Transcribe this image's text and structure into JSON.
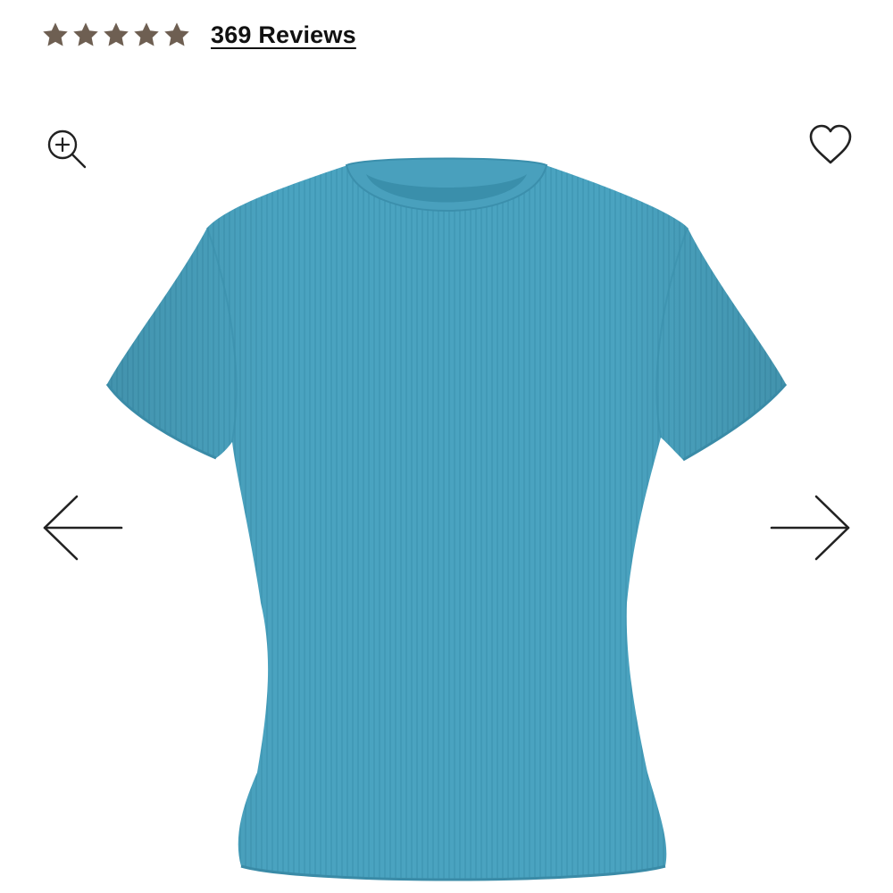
{
  "rating": {
    "stars_filled": 5,
    "stars_total": 5,
    "star_color": "#6e5f52",
    "reviews_label": "369 Reviews"
  },
  "gallery": {
    "zoom_icon": "zoom-in-icon",
    "wishlist_icon": "heart-icon",
    "prev_icon": "arrow-left-icon",
    "next_icon": "arrow-right-icon",
    "product_color": "#4aa3c0",
    "icon_color": "#222222"
  }
}
